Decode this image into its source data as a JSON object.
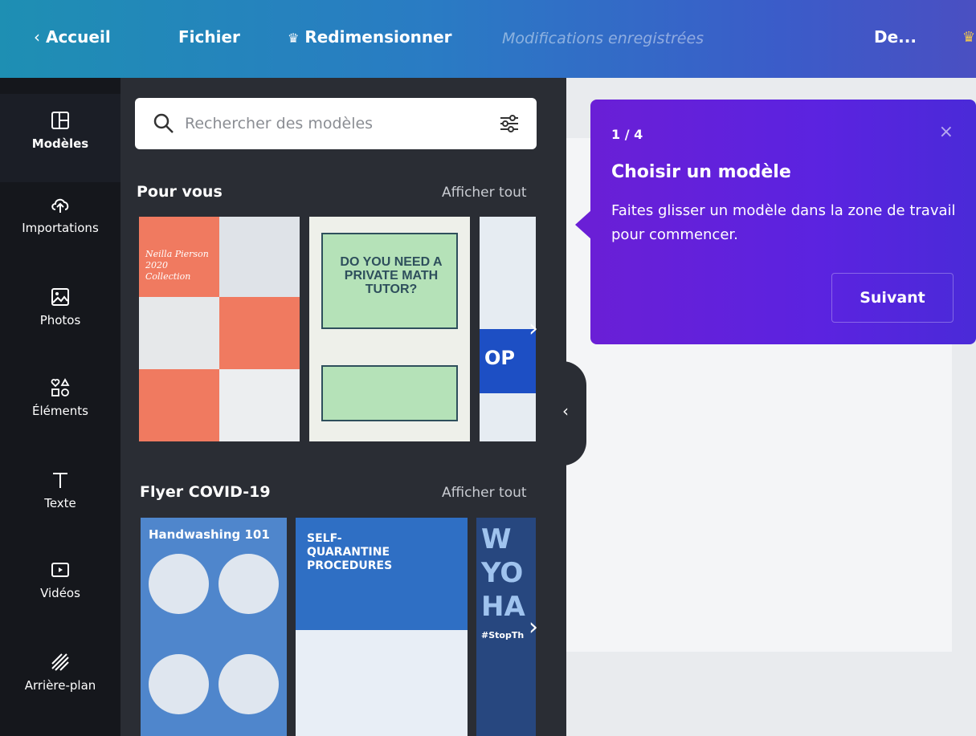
{
  "topbar": {
    "home": "Accueil",
    "file": "Fichier",
    "resize": "Redimensionner",
    "saved_status": "Modifications enregistrées",
    "truncated_item": "De..."
  },
  "rail": {
    "items": [
      {
        "label": "Modèles",
        "icon": "templates-icon"
      },
      {
        "label": "Importations",
        "icon": "upload-cloud-icon"
      },
      {
        "label": "Photos",
        "icon": "photo-icon"
      },
      {
        "label": "Éléments",
        "icon": "elements-icon"
      },
      {
        "label": "Texte",
        "icon": "text-icon"
      },
      {
        "label": "Vidéos",
        "icon": "video-icon"
      },
      {
        "label": "Arrière-plan",
        "icon": "background-icon"
      }
    ]
  },
  "search": {
    "placeholder": "Rechercher des modèles"
  },
  "sections": [
    {
      "title": "Pour vous",
      "see_all": "Afficher tout",
      "thumbs": [
        {
          "title": "Neilla Pierson 2020 Collection"
        },
        {
          "title": "DO YOU NEED A PRIVATE MATH TUTOR?"
        },
        {
          "title": "OP"
        }
      ]
    },
    {
      "title": "Flyer COVID-19",
      "see_all": "Afficher tout",
      "thumbs": [
        {
          "title": "Handwashing 101"
        },
        {
          "title": "SELF-QUARANTINE PROCEDURES"
        },
        {
          "title": "W YO HA",
          "tag": "#StopTh"
        }
      ]
    }
  ],
  "tooltip": {
    "step": "1 / 4",
    "title": "Choisir un modèle",
    "description": "Faites glisser un modèle dans la zone de travail pour commencer.",
    "next": "Suivant",
    "close": "×"
  },
  "colors": {
    "tooltip_bg": "#6a1fd6",
    "panel_bg": "#2a2d34",
    "rail_bg": "#15171c"
  }
}
